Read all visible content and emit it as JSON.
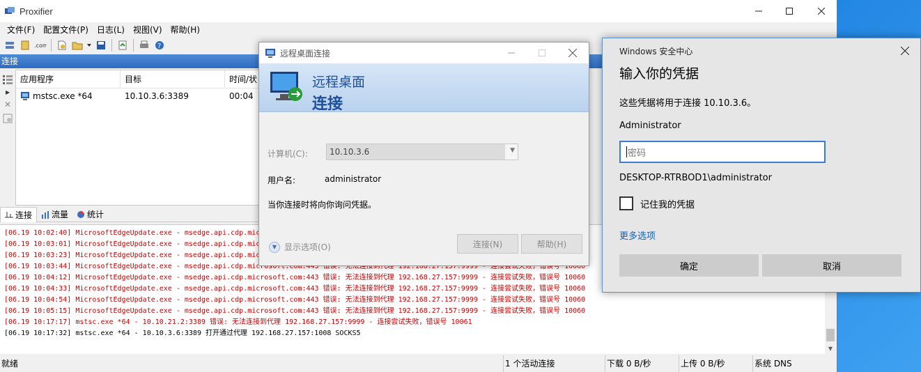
{
  "proxifier": {
    "title": "Proxifier",
    "menu": [
      "文件(F)",
      "配置文件(P)",
      "日志(L)",
      "视图(V)",
      "帮助(H)"
    ],
    "section_header": "连接",
    "connections": {
      "columns": [
        "应用程序",
        "目标",
        "时间/状"
      ],
      "rows": [
        {
          "app": "mstsc.exe *64",
          "target": "10.10.3.6:3389",
          "time": "00:04"
        }
      ]
    },
    "tabs": [
      "连接",
      "流量",
      "统计"
    ],
    "log": [
      {
        "text": "[06.19 10:02:40] MicrosoftEdgeUpdate.exe - msedge.api.cdp.microsoft.com:443 错误: 无法连接到代理 192.168.27.157:9999 - 连接尝试失败，错误号 10060",
        "type": "err"
      },
      {
        "text": "[06.19 10:03:01] MicrosoftEdgeUpdate.exe - msedge.api.cdp.microsoft.com:443 错误: 无法连接到代理 192.168.27.157:9999 - 连接尝试失败，错误号 10060",
        "type": "err"
      },
      {
        "text": "[06.19 10:03:23] MicrosoftEdgeUpdate.exe - msedge.api.cdp.microsoft.com:443 错误: 无法连接到代理 192.168.27.157:9999 - 连接尝试失败，错误号 10060",
        "type": "err"
      },
      {
        "text": "[06.19 10:03:44] MicrosoftEdgeUpdate.exe - msedge.api.cdp.microsoft.com:443 错误: 无法连接到代理 192.168.27.157:9999 - 连接尝试失败，错误号 10060",
        "type": "err"
      },
      {
        "text": "[06.19 10:04:12] MicrosoftEdgeUpdate.exe - msedge.api.cdp.microsoft.com:443 错误: 无法连接到代理 192.168.27.157:9999 - 连接尝试失败，错误号 10060",
        "type": "err"
      },
      {
        "text": "[06.19 10:04:33] MicrosoftEdgeUpdate.exe - msedge.api.cdp.microsoft.com:443 错误: 无法连接到代理 192.168.27.157:9999 - 连接尝试失败，错误号 10060",
        "type": "err"
      },
      {
        "text": "[06.19 10:04:54] MicrosoftEdgeUpdate.exe - msedge.api.cdp.microsoft.com:443 错误: 无法连接到代理 192.168.27.157:9999 - 连接尝试失败，错误号 10060",
        "type": "err"
      },
      {
        "text": "[06.19 10:05:15] MicrosoftEdgeUpdate.exe - msedge.api.cdp.microsoft.com:443 错误: 无法连接到代理 192.168.27.157:9999 - 连接尝试失败，错误号 10060",
        "type": "err"
      },
      {
        "text": "[06.19 10:17:17] mstsc.exe *64 - 10.10.21.2:3389 错误: 无法连接到代理 192.168.27.157:9999 - 连接尝试失败，错误号 10061",
        "type": "err"
      },
      {
        "text": "[06.19 10:17:32] mstsc.exe *64 - 10.10.3.6:3389 打开通过代理 192.168.27.157:1008 SOCKS5",
        "type": "ok"
      }
    ],
    "status": {
      "ready": "就绪",
      "active": "1 个活动连接",
      "down": "下载 0 B/秒",
      "up": "上传 0 B/秒",
      "dns": "系统 DNS"
    }
  },
  "rdp": {
    "title": "远程桌面连接",
    "banner_line1": "远程桌面",
    "banner_line2": "连接",
    "computer_label": "计算机(C):",
    "computer_value": "10.10.3.6",
    "user_label": "用户名:",
    "user_value": "administrator",
    "info": "当你连接时将向你询问凭据。",
    "show_options": "显示选项(O)",
    "connect_btn": "连接(N)",
    "help_btn": "帮助(H)"
  },
  "winsec": {
    "title": "Windows 安全中心",
    "heading": "输入你的凭据",
    "desc": "这些凭据将用于连接 10.10.3.6。",
    "username": "Administrator",
    "password_placeholder": "密码",
    "domain_user": "DESKTOP-RTRBOD1\\administrator",
    "remember": "记住我的凭据",
    "more_options": "更多选项",
    "ok_btn": "确定",
    "cancel_btn": "取消"
  },
  "colors": {
    "error_text": "#c80000",
    "accent": "#3a7bd5",
    "link": "#0b62c6"
  }
}
